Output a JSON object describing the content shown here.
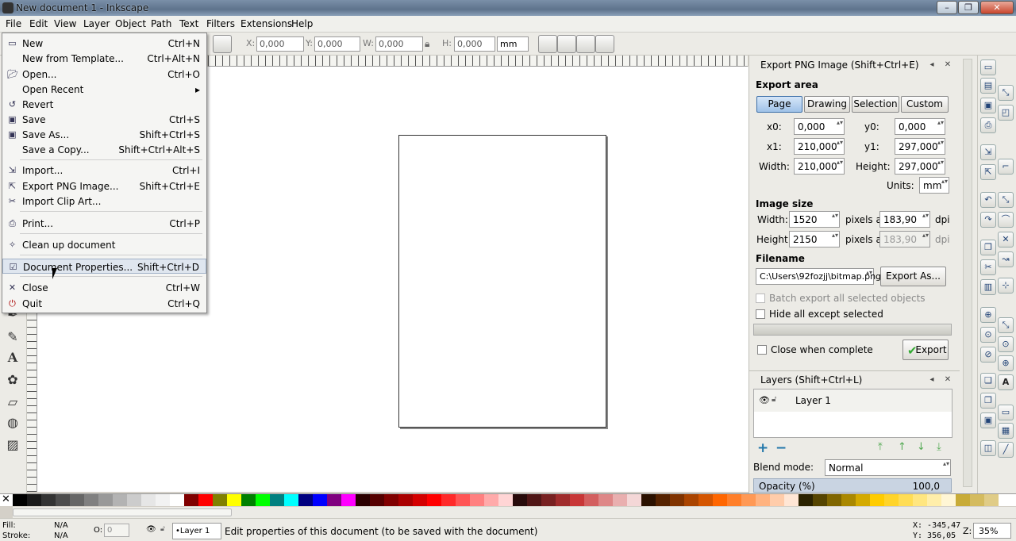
{
  "window": {
    "title": "New document 1 - Inkscape",
    "buttons": [
      "–",
      "❐",
      "✕"
    ]
  },
  "menubar": [
    "File",
    "Edit",
    "View",
    "Layer",
    "Object",
    "Path",
    "Text",
    "Filters",
    "Extensions",
    "Help"
  ],
  "toolbar": {
    "x_label": "X:",
    "x_value": "0,000",
    "y_label": "Y:",
    "y_value": "0,000",
    "w_label": "W:",
    "w_value": "0,000",
    "h_label": "H:",
    "h_value": "0,000",
    "unit": "mm"
  },
  "file_menu": [
    {
      "icon": "new-doc-icon",
      "label": "New",
      "shortcut": "Ctrl+N"
    },
    {
      "icon": "",
      "label": "New from Template...",
      "shortcut": "Ctrl+Alt+N"
    },
    {
      "icon": "folder-open-icon",
      "label": "Open...",
      "shortcut": "Ctrl+O"
    },
    {
      "icon": "",
      "label": "Open Recent",
      "shortcut": "▸"
    },
    {
      "icon": "revert-icon",
      "label": "Revert",
      "shortcut": ""
    },
    {
      "icon": "save-icon",
      "label": "Save",
      "shortcut": "Ctrl+S"
    },
    {
      "icon": "save-as-icon",
      "label": "Save As...",
      "shortcut": "Shift+Ctrl+S"
    },
    {
      "icon": "",
      "label": "Save a Copy...",
      "shortcut": "Shift+Ctrl+Alt+S"
    },
    {
      "icon": "import-icon",
      "label": "Import...",
      "shortcut": "Ctrl+I"
    },
    {
      "icon": "export-png-icon",
      "label": "Export PNG Image...",
      "shortcut": "Shift+Ctrl+E"
    },
    {
      "icon": "clip-art-icon",
      "label": "Import Clip Art...",
      "shortcut": ""
    },
    {
      "icon": "print-icon",
      "label": "Print...",
      "shortcut": "Ctrl+P"
    },
    {
      "icon": "clean-up-icon",
      "label": "Clean up document",
      "shortcut": ""
    },
    {
      "icon": "document-properties-icon",
      "label": "Document Properties...",
      "shortcut": "Shift+Ctrl+D"
    },
    {
      "icon": "close-icon",
      "label": "Close",
      "shortcut": "Ctrl+W"
    },
    {
      "icon": "quit-icon",
      "label": "Quit",
      "shortcut": "Ctrl+Q"
    }
  ],
  "export_panel": {
    "title": "Export PNG Image (Shift+Ctrl+E)",
    "export_area_label": "Export area",
    "area_buttons": [
      "Page",
      "Drawing",
      "Selection",
      "Custom"
    ],
    "x0_label": "x0:",
    "x0": "0,000",
    "y0_label": "y0:",
    "y0": "0,000",
    "x1_label": "x1:",
    "x1": "210,000",
    "y1_label": "y1:",
    "y1": "297,000",
    "width_label": "Width:",
    "width": "210,000",
    "height_label": "Height:",
    "height": "297,000",
    "units_label": "Units:",
    "units": "mm",
    "image_size_label": "Image size",
    "img_width_label": "Width:",
    "img_width": "1520",
    "img_height_label": "Height:",
    "img_height": "2150",
    "pixels_at": "pixels at",
    "dpi_x": "183,90",
    "dpi_y": "183,90",
    "dpi_label": "dpi",
    "filename_label": "Filename",
    "filename": "C:\\Users\\92fozjj\\bitmap.png",
    "export_as_button": "Export As...",
    "batch_export": "Batch export all selected objects",
    "hide_all": "Hide all except selected",
    "close_when_complete": "Close when complete",
    "export_button": "Export"
  },
  "layers_panel": {
    "title": "Layers (Shift+Ctrl+L)",
    "layer_name": "Layer 1",
    "blend_mode_label": "Blend mode:",
    "blend_mode": "Normal",
    "opacity_label": "Opacity (%)",
    "opacity": "100,0"
  },
  "palette_colors": [
    "#000000",
    "#1a1a1a",
    "#333333",
    "#4d4d4d",
    "#666666",
    "#808080",
    "#999999",
    "#b3b3b3",
    "#cccccc",
    "#e6e6e6",
    "#f2f2f2",
    "#ffffff",
    "#800000",
    "#ff0000",
    "#808000",
    "#ffff00",
    "#008000",
    "#00ff00",
    "#008080",
    "#00ffff",
    "#000080",
    "#0000ff",
    "#800080",
    "#ff00ff",
    "#2b0000",
    "#550000",
    "#800000",
    "#aa0000",
    "#d40000",
    "#ff0000",
    "#ff2a2a",
    "#ff5555",
    "#ff8080",
    "#ffaaaa",
    "#ffd5d5",
    "#280b0b",
    "#501616",
    "#782121",
    "#a02c2c",
    "#c83737",
    "#d35f5f",
    "#de8787",
    "#e9afaf",
    "#f4d7d7",
    "#2b1100",
    "#552200",
    "#803300",
    "#aa4400",
    "#d45500",
    "#ff6600",
    "#ff7f2a",
    "#ff9955",
    "#ffb380",
    "#ffccaa",
    "#ffe6d5",
    "#2b2200",
    "#554400",
    "#806600",
    "#aa8800",
    "#d4aa00",
    "#ffcc00",
    "#ffd42a",
    "#ffdd55",
    "#ffe680",
    "#ffeeaa",
    "#fff6d5",
    "#c8ab37",
    "#d4bb5f",
    "#e0cc87"
  ],
  "status": {
    "fill_label": "Fill:",
    "fill": "N/A",
    "stroke_label": "Stroke:",
    "stroke": "N/A",
    "opacity_label": "O:",
    "opacity": "0",
    "layer": "•Layer 1",
    "message": "Edit properties of this document (to be saved with the document)",
    "x_coord": "X: -345,47",
    "y_coord": "Y: 356,05",
    "zoom_label": "Z:",
    "zoom": "35%"
  }
}
